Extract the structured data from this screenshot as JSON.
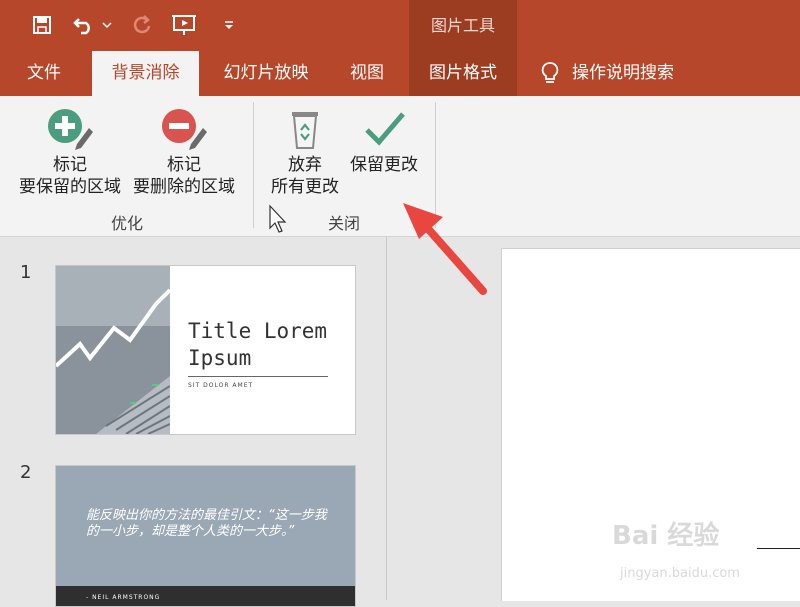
{
  "app": {
    "context_group_title": "图片工具"
  },
  "tabs": [
    {
      "label": "文件",
      "active": false
    },
    {
      "label": "背景消除",
      "active": true
    },
    {
      "label": "幻灯片放映",
      "active": false
    },
    {
      "label": "视图",
      "active": false
    },
    {
      "label": "图片格式",
      "active": false
    }
  ],
  "tell_me": {
    "label": "操作说明搜索"
  },
  "ribbon": {
    "groups": [
      {
        "label": "优化"
      },
      {
        "label": "关闭"
      }
    ],
    "buttons": {
      "mark_keep": {
        "line1": "标记",
        "line2": "要保留的区域"
      },
      "mark_remove": {
        "line1": "标记",
        "line2": "要删除的区域"
      },
      "discard": {
        "line1": "放弃",
        "line2": "所有更改"
      },
      "keep_changes": {
        "line1": "保留更改"
      }
    }
  },
  "slides": [
    {
      "number": "1",
      "title": "Title Lorem Ipsum",
      "subtitle": "SIT DOLOR AMET"
    },
    {
      "number": "2",
      "quote": "能反映出你的方法的最佳引文：“这一步我的一小步，却是整个人类的一大步。”",
      "author": "- NEIL ARMSTRONG"
    }
  ],
  "watermark": {
    "brand": "Bai 经验",
    "url": "jingyan.baidu.com"
  },
  "colors": {
    "accent": "#b7472a",
    "context": "#9c3d22",
    "keep_green": "#4a9d7f",
    "remove_red": "#d9534f",
    "arrow": "#e8463f"
  }
}
